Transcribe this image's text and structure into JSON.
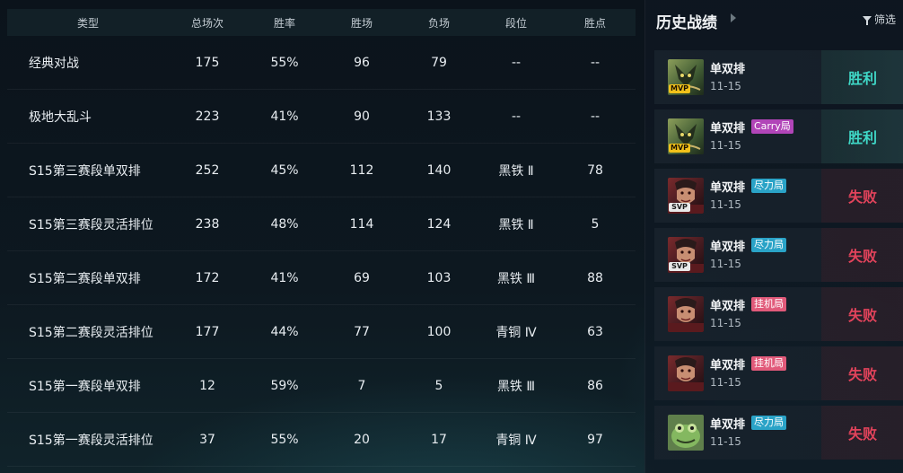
{
  "stats_table": {
    "headers": [
      "类型",
      "总场次",
      "胜率",
      "胜场",
      "负场",
      "段位",
      "胜点"
    ],
    "rows": [
      [
        "经典对战",
        "175",
        "55%",
        "96",
        "79",
        "--",
        "--"
      ],
      [
        "极地大乱斗",
        "223",
        "41%",
        "90",
        "133",
        "--",
        "--"
      ],
      [
        "S15第三赛段单双排",
        "252",
        "45%",
        "112",
        "140",
        "黑铁 Ⅱ",
        "78"
      ],
      [
        "S15第三赛段灵活排位",
        "238",
        "48%",
        "114",
        "124",
        "黑铁 Ⅱ",
        "5"
      ],
      [
        "S15第二赛段单双排",
        "172",
        "41%",
        "69",
        "103",
        "黑铁 Ⅲ",
        "88"
      ],
      [
        "S15第二赛段灵活排位",
        "177",
        "44%",
        "77",
        "100",
        "青铜 Ⅳ",
        "63"
      ],
      [
        "S15第一赛段单双排",
        "12",
        "59%",
        "7",
        "5",
        "黑铁 Ⅲ",
        "86"
      ],
      [
        "S15第一赛段灵活排位",
        "37",
        "55%",
        "20",
        "17",
        "青铜 Ⅳ",
        "97"
      ]
    ]
  },
  "history": {
    "title": "历史战绩",
    "filter_label": "筛选",
    "matches": [
      {
        "mode": "单双排",
        "tag": "",
        "tag_type": "",
        "date": "11-15",
        "result": "胜利",
        "outcome": "win",
        "badge": "MVP",
        "badge_type": "mvp",
        "champion_icon": "green-champion-icon"
      },
      {
        "mode": "单双排",
        "tag": "Carry局",
        "tag_type": "carry",
        "date": "11-15",
        "result": "胜利",
        "outcome": "win",
        "badge": "MVP",
        "badge_type": "mvp",
        "champion_icon": "green-champion-icon"
      },
      {
        "mode": "单双排",
        "tag": "尽力局",
        "tag_type": "effort",
        "date": "11-15",
        "result": "失败",
        "outcome": "lose",
        "badge": "SVP",
        "badge_type": "svp",
        "champion_icon": "red-champion-icon"
      },
      {
        "mode": "单双排",
        "tag": "尽力局",
        "tag_type": "effort",
        "date": "11-15",
        "result": "失败",
        "outcome": "lose",
        "badge": "SVP",
        "badge_type": "svp",
        "champion_icon": "red-champion-icon"
      },
      {
        "mode": "单双排",
        "tag": "挂机局",
        "tag_type": "afk",
        "date": "11-15",
        "result": "失败",
        "outcome": "lose",
        "badge": "",
        "badge_type": "",
        "champion_icon": "red-champion-icon"
      },
      {
        "mode": "单双排",
        "tag": "挂机局",
        "tag_type": "afk",
        "date": "11-15",
        "result": "失败",
        "outcome": "lose",
        "badge": "",
        "badge_type": "",
        "champion_icon": "red-champion-icon"
      },
      {
        "mode": "单双排",
        "tag": "尽力局",
        "tag_type": "effort",
        "date": "11-15",
        "result": "失败",
        "outcome": "lose",
        "badge": "",
        "badge_type": "",
        "champion_icon": "frog-champion-icon"
      }
    ]
  },
  "colors": {
    "win": "#3fd7c6",
    "lose": "#e2435b",
    "carry_tag": "#b145b8",
    "effort_tag": "#2aa3c7",
    "afk_tag": "#e15a7a",
    "mvp_badge": "#f2c11a"
  }
}
